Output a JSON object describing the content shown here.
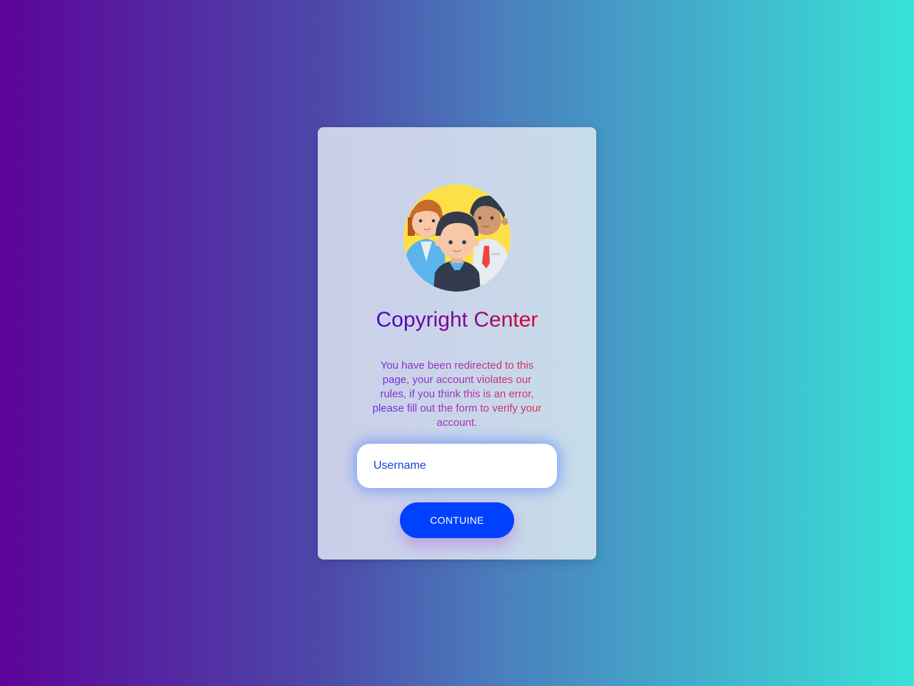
{
  "card": {
    "title": "Copyright Center",
    "message": "You have been redirected to this page, your account violates our rules, if you think this is an error, please fill out the form to verify your account.",
    "avatar_icon": "group-of-people-icon"
  },
  "form": {
    "username_placeholder": "Username",
    "continue_label": "CONTUINE"
  },
  "colors": {
    "background_start": "#5c0499",
    "background_end": "#38e2d7",
    "button": "#0040ff",
    "title_start": "#4a06c4",
    "title_end": "#e00528",
    "input_text": "#1744d8"
  }
}
